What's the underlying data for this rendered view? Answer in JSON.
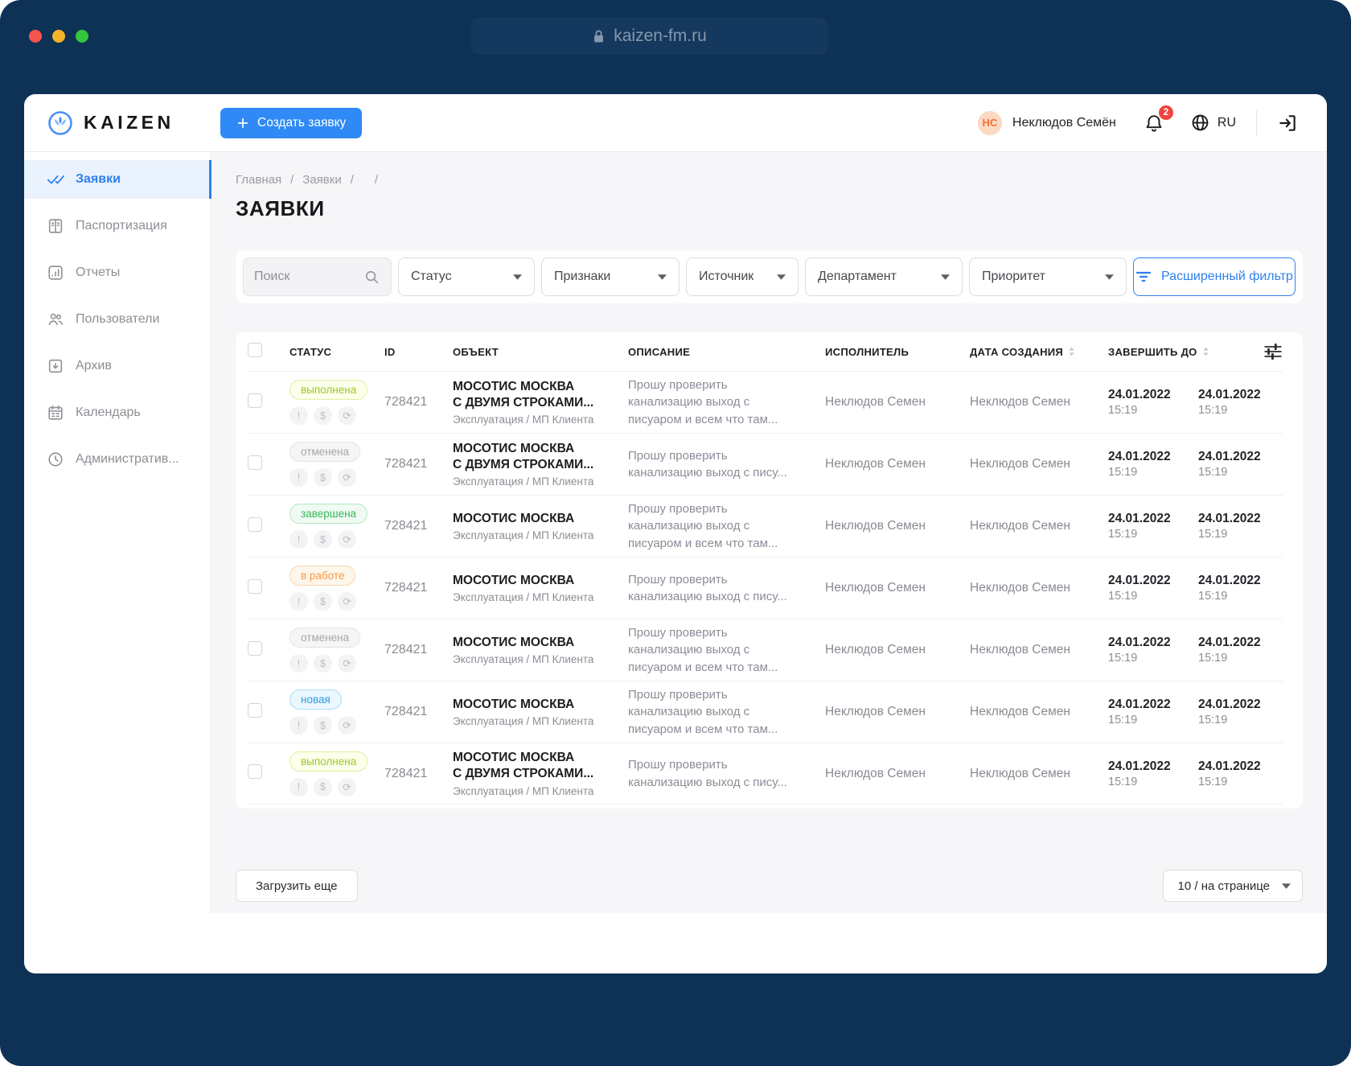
{
  "browser": {
    "url": "kaizen-fm.ru"
  },
  "colors": {
    "accent": "#2f8af5",
    "link": "#2f80ed",
    "notification": "#f0443c",
    "status_done": "#9dc726",
    "status_cancelled": "#a6a6ac",
    "status_finished": "#3cb55e",
    "status_progress": "#f2994a",
    "status_new": "#2d9cdb"
  },
  "header": {
    "brand": "KAIZEN",
    "create_button": "Создать заявку",
    "user": {
      "initials": "НС",
      "name": "Неклюдов Семён"
    },
    "notifications_count": "2",
    "language": "RU"
  },
  "sidebar": {
    "items": [
      {
        "label": "Заявки",
        "active": true
      },
      {
        "label": "Паспортизация"
      },
      {
        "label": "Отчеты"
      },
      {
        "label": "Пользователи"
      },
      {
        "label": "Архив"
      },
      {
        "label": "Календарь"
      },
      {
        "label": "Административ..."
      }
    ]
  },
  "breadcrumb": {
    "items": [
      "Главная",
      "Заявки",
      ""
    ],
    "separator": "/"
  },
  "page": {
    "title": "ЗАЯВКИ"
  },
  "filters": {
    "search_placeholder": "Поиск",
    "status": "Статус",
    "features": "Признаки",
    "source": "Источник",
    "department": "Департамент",
    "priority": "Приоритет",
    "advanced": "Расширенный фильтр"
  },
  "table": {
    "columns": {
      "status": "СТАТУС",
      "id": "ID",
      "object": "ОБЪЕКТ",
      "description": "ОПИСАНИЕ",
      "executor": "ИСПОЛНИТЕЛЬ",
      "created": "ДАТА СОЗДАНИЯ",
      "due": "ЗАВЕРШИТЬ ДО"
    },
    "row_icons": {
      "urgent": "!",
      "paid": "$",
      "repeat": "⟳"
    },
    "rows": [
      {
        "status": "выполнена",
        "status_type": "done",
        "id": "728421",
        "object": "МОСОТИС МОСКВА\nС ДВУМЯ СТРОКАМИ...",
        "object_sub": "Эксплуатация / МП Клиента",
        "description": "Прошу проверить\nканализацию выход с\nписуаром и всем что там...",
        "executor": "Неклюдов Семен",
        "author": "Неклюдов Семен",
        "created_date": "24.01.2022",
        "created_time": "15:19",
        "due_date": "24.01.2022",
        "due_time": "15:19"
      },
      {
        "status": "отменена",
        "status_type": "cancelled",
        "id": "728421",
        "object": "МОСОТИС МОСКВА\nС ДВУМЯ СТРОКАМИ...",
        "object_sub": "Эксплуатация / МП Клиента",
        "description": "Прошу проверить\nканализацию выход с пису...",
        "executor": "Неклюдов Семен",
        "author": "Неклюдов Семен",
        "created_date": "24.01.2022",
        "created_time": "15:19",
        "due_date": "24.01.2022",
        "due_time": "15:19"
      },
      {
        "status": "завершена",
        "status_type": "finished",
        "id": "728421",
        "object": "МОСОТИС МОСКВА",
        "object_sub": "Эксплуатация / МП Клиента",
        "description": "Прошу проверить\nканализацию выход с\nписуаром и всем что там...",
        "executor": "Неклюдов Семен",
        "author": "Неклюдов Семен",
        "created_date": "24.01.2022",
        "created_time": "15:19",
        "due_date": "24.01.2022",
        "due_time": "15:19"
      },
      {
        "status": "в работе",
        "status_type": "progress",
        "id": "728421",
        "object": "МОСОТИС МОСКВА",
        "object_sub": "Эксплуатация / МП Клиента",
        "description": "Прошу проверить\nканализацию выход с пису...",
        "executor": "Неклюдов Семен",
        "author": "Неклюдов Семен",
        "created_date": "24.01.2022",
        "created_time": "15:19",
        "due_date": "24.01.2022",
        "due_time": "15:19"
      },
      {
        "status": "отменена",
        "status_type": "cancelled",
        "id": "728421",
        "object": "МОСОТИС МОСКВА",
        "object_sub": "Эксплуатация / МП Клиента",
        "description": "Прошу проверить\nканализацию выход с\nписуаром и всем что там...",
        "executor": "Неклюдов Семен",
        "author": "Неклюдов Семен",
        "created_date": "24.01.2022",
        "created_time": "15:19",
        "due_date": "24.01.2022",
        "due_time": "15:19"
      },
      {
        "status": "новая",
        "status_type": "new",
        "id": "728421",
        "object": "МОСОТИС МОСКВА",
        "object_sub": "Эксплуатация / МП Клиента",
        "description": "Прошу проверить\nканализацию выход с\nписуаром и всем что там...",
        "executor": "Неклюдов Семен",
        "author": "Неклюдов Семен",
        "created_date": "24.01.2022",
        "created_time": "15:19",
        "due_date": "24.01.2022",
        "due_time": "15:19"
      },
      {
        "status": "выполнена",
        "status_type": "done",
        "id": "728421",
        "object": "МОСОТИС МОСКВА\nС ДВУМЯ СТРОКАМИ...",
        "object_sub": "Эксплуатация / МП Клиента",
        "description": "Прошу проверить\nканализацию выход с пису...",
        "executor": "Неклюдов Семен",
        "author": "Неклюдов Семен",
        "created_date": "24.01.2022",
        "created_time": "15:19",
        "due_date": "24.01.2022",
        "due_time": "15:19"
      }
    ]
  },
  "pagination": {
    "load_more": "Загрузить еще",
    "per_page": "10 / на странице"
  }
}
